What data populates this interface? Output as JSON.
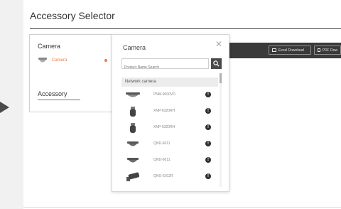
{
  "page": {
    "title": "Accessory Selector"
  },
  "left_card": {
    "camera_label": "Camera",
    "selected_camera": "Camera",
    "accessory_label": "Accessory"
  },
  "toolbar": {
    "excel_label": "Excel Download",
    "pdf_label": "PDF Dow"
  },
  "popup": {
    "title": "Camera",
    "close_icon": "close-icon",
    "search_placeholder": "Product Name Search",
    "group_label": "Network camera",
    "items": [
      {
        "name": "PNM-9000VD",
        "icon": "multi-sensor-camera-icon"
      },
      {
        "name": "XNP-6320RH",
        "icon": "ptz-camera-icon"
      },
      {
        "name": "XNP-6320RH",
        "icon": "ptz-camera-icon"
      },
      {
        "name": "QND-6011",
        "icon": "dome-camera-icon"
      },
      {
        "name": "QND-6011",
        "icon": "dome-camera-icon"
      },
      {
        "name": "QNO-6012R",
        "icon": "bullet-camera-icon"
      }
    ]
  },
  "colors": {
    "accent": "#e87b4d",
    "dark_bar": "#3a3a3a",
    "info_dot": "#2f2f2f"
  }
}
